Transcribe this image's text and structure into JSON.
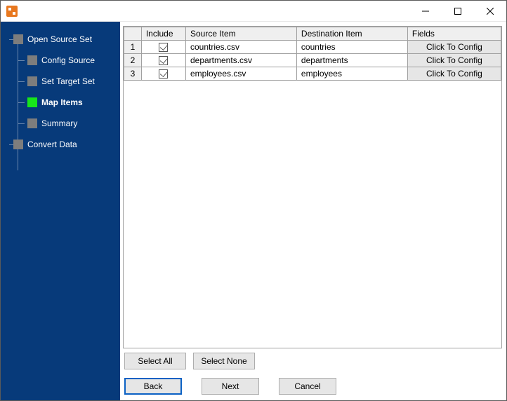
{
  "sidebar": {
    "items": [
      {
        "label": "Open Source Set",
        "level": 0,
        "current": false
      },
      {
        "label": "Config Source",
        "level": 1,
        "current": false
      },
      {
        "label": "Set Target Set",
        "level": 1,
        "current": false
      },
      {
        "label": "Map Items",
        "level": 1,
        "current": true
      },
      {
        "label": "Summary",
        "level": 1,
        "current": false
      },
      {
        "label": "Convert Data",
        "level": 0,
        "current": false
      }
    ]
  },
  "grid": {
    "headers": {
      "include": "Include",
      "source": "Source Item",
      "dest": "Destination Item",
      "fields": "Fields"
    },
    "rows": [
      {
        "n": "1",
        "include": true,
        "source": "countries.csv",
        "dest": "countries",
        "fields_btn": "Click To Config"
      },
      {
        "n": "2",
        "include": true,
        "source": "departments.csv",
        "dest": "departments",
        "fields_btn": "Click To Config"
      },
      {
        "n": "3",
        "include": true,
        "source": "employees.csv",
        "dest": "employees",
        "fields_btn": "Click To Config"
      }
    ]
  },
  "buttons": {
    "select_all": "Select All",
    "select_none": "Select None",
    "back": "Back",
    "next": "Next",
    "cancel": "Cancel"
  }
}
